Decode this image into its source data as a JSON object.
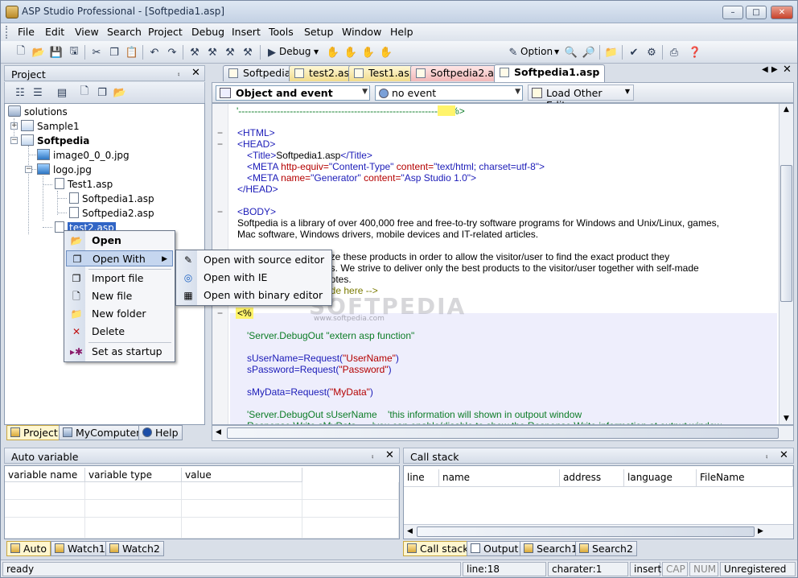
{
  "window": {
    "title": "ASP Studio Professional - [Softpedia1.asp]"
  },
  "menu": [
    "File",
    "Edit",
    "View",
    "Search",
    "Project",
    "Debug",
    "Insert",
    "Tools",
    "Setup",
    "Window",
    "Help"
  ],
  "toolbar": {
    "debug_label": "Debug",
    "option_label": "Option"
  },
  "project_panel": {
    "title": "Project",
    "tree": {
      "root": "solutions",
      "sample1": "Sample1",
      "softpedia": "Softpedia",
      "image": "image0_0_0.jpg",
      "logo": "logo.jpg",
      "test1": "Test1.asp",
      "softpedia1": "Softpedia1.asp",
      "softpedia2": "Softpedia2.asp",
      "test2": "test2.asp"
    },
    "tabs": [
      "Project",
      "MyComputer",
      "Help"
    ]
  },
  "context_menu": {
    "items": [
      "Open",
      "Open With",
      "Import file",
      "New file",
      "New folder",
      "Delete",
      "Set as startup"
    ],
    "submenu": [
      "Open with source editor",
      "Open with IE",
      "Open with binary editor"
    ]
  },
  "editor": {
    "tabs": [
      "Softpedia",
      "test2.asp",
      "Test1.asp",
      "Softpedia2.asp",
      "Softpedia1.asp"
    ],
    "object_combo": "Object and event",
    "event_combo": "no event",
    "load_other": "Load Other Editor",
    "code": {
      "l0": "'------------------------------------------------------------------%>",
      "html_open": "<HTML>",
      "head_open": "<HEAD>",
      "title_line_tag1": "<Title>",
      "title_text": "Softpedia1.asp",
      "title_line_tag2": "</Title>",
      "meta1_tag": "<META",
      "meta1_attr1": "http-equiv=",
      "meta1_val1": "\"Content-Type\"",
      "meta1_attr2": "content=",
      "meta1_val2": "\"text/html; charset=utf-8\"",
      "meta1_end": ">",
      "meta2_tag": "<META",
      "meta2_attr1": "name=",
      "meta2_val1": "\"Generator\"",
      "meta2_attr2": "content=",
      "meta2_val2": "\"Asp Studio 1.0\"",
      "meta2_end": ">",
      "head_close": "</HEAD>",
      "body_open": "<BODY>",
      "body1": "Softpedia is a library of over 400,000 free and free-to-try software programs for Windows and Unix/Linux, games,",
      "body2": "Mac software, Windows drivers, mobile devices and IT-related articles.",
      "body3": "rize these products in order to allow the visitor/user to find the exact product they",
      "body4": "ds. We strive to deliver only the best products to the visitor/user together with self-made",
      "body5": "notes.",
      "body6": "ode here -->",
      "asp_open": "<%",
      "s1a": "'Server.DebugOut \"extern asp function\"",
      "s2a": "sUserName=Request(",
      "s2b": "\"UserName\"",
      "s2c": ")",
      "s3a": "sPassword=Request(",
      "s3b": "\"Password\"",
      "s3c": ")",
      "s4a": "sMyData=Request(",
      "s4b": "\"MyData\"",
      "s4c": ")",
      "s5": "'Server.DebugOut sUserName    'this information will shown in outpout window",
      "s6": "Response.Write sMyData      'you can enable/disable to show the Response.Write information at output window"
    }
  },
  "watermark": "SOFTPEDIA",
  "watermark_url": "www.softpedia.com",
  "auto_panel": {
    "title": "Auto variable",
    "columns": [
      "variable name",
      "variable type",
      "value"
    ],
    "tabs": [
      "Auto",
      "Watch1",
      "Watch2"
    ]
  },
  "callstack_panel": {
    "title": "Call stack",
    "columns": [
      "line",
      "name",
      "address",
      "language",
      "FileName"
    ],
    "tabs": [
      "Call stack",
      "Output",
      "Search1",
      "Search2"
    ]
  },
  "statusbar": {
    "ready": "ready",
    "line": "line:18",
    "char": "charater:1",
    "insert": "insert",
    "cap": "CAP",
    "num": "NUM",
    "reg": "Unregistered"
  }
}
